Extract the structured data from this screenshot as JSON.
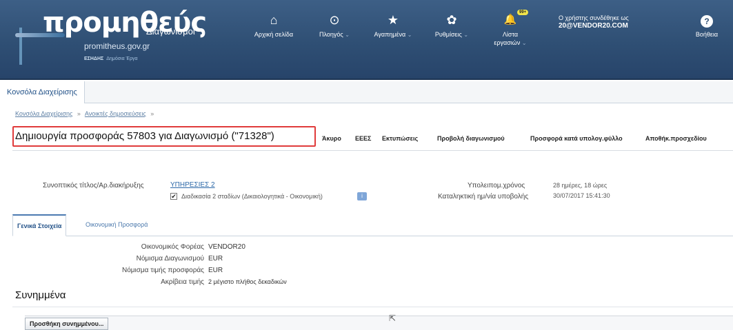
{
  "header": {
    "logo_word": "προμηθεύς",
    "logo_subtitle": "Διαγωνισμοί",
    "logo_url": "promitheus.gov.gr",
    "logo_ministry": "ΕΣΗΔΗΣ",
    "logo_ministry_sub": "Δημόσια Έργα",
    "nav": [
      {
        "label": "Αρχική σελίδα",
        "icon": "home-icon",
        "glyph": "⌂",
        "dropdown": ""
      },
      {
        "label": "Πλοηγός",
        "icon": "compass-icon",
        "glyph": "⊙",
        "dropdown": "⌄"
      },
      {
        "label": "Αγαπημένα",
        "icon": "star-icon",
        "glyph": "★",
        "dropdown": "⌄"
      },
      {
        "label": "Ρυθμίσεις",
        "icon": "gear-icon",
        "glyph": "✿",
        "dropdown": "⌄"
      },
      {
        "label": "Λίστα εργασιών",
        "icon": "bell-icon",
        "glyph": "🔔",
        "dropdown": "⌄",
        "badge": "99+"
      }
    ],
    "user_line1": "Ο χρήστης συνδέθηκε ως",
    "user_id": "20@VENDOR20.COM",
    "help_label": "Βοήθεια",
    "help_glyph": "?"
  },
  "console_tab": "Κονσόλα Διαχείρισης",
  "breadcrumb": [
    "Κονσόλα Διαχείρισης",
    "Ανοικτές δημοσιεύσεις"
  ],
  "breadcrumb_sep": "»",
  "page_title": "Δημιουργία προσφοράς 57803 για Διαγωνισμό (\"71328\")",
  "toolbar": [
    "Άκυρο",
    "ΕΕΕΣ",
    "Εκτυπώσεις",
    "Προβολή διαγωνισμού",
    "Προσφορά κατά υπολογ.φύλλο",
    "Αποθήκ.προσχεδίου"
  ],
  "summary": {
    "title_label": "Συνοπτικός τίτλος/Αρ.διακήρυξης",
    "title_value": "ΥΠΗΡΕΣΙΕΣ 2",
    "two_stage_checked": "✔",
    "two_stage_label": "Διαδικασία 2 σταδίων (Δικαιολογητικά - Οικονομική)",
    "info_glyph": "i",
    "remaining_label": "Υπολειπομ.χρόνος",
    "remaining_value": "28 ημέρες, 18 ώρες",
    "deadline_label": "Καταληκτική ημ/νία υποβολής",
    "deadline_value": "30/07/2017 15:41:30"
  },
  "inner_tabs": [
    "Γενικά Στοιχεία",
    "Οικονομική Προσφορά"
  ],
  "details": [
    {
      "label": "Οικονομικός Φορέας",
      "value": "VENDOR20"
    },
    {
      "label": "Νόμισμα Διαγωνισμού",
      "value": "EUR"
    },
    {
      "label": "Νόμισμα τιμής προσφοράς",
      "value": "EUR"
    },
    {
      "label": "Ακρίβεια τιμής",
      "value": "2 μέγιστο πλήθος δεκαδικών"
    }
  ],
  "attachments": {
    "title": "Συνημμένα",
    "add_button": "Προσθήκη συνημμένου..."
  }
}
